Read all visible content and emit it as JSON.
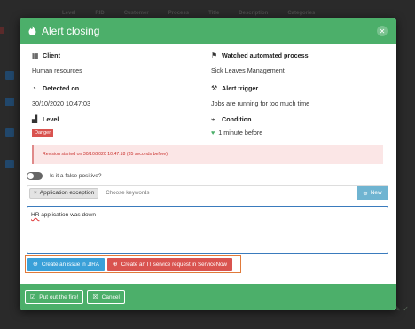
{
  "background": {
    "columns": [
      "Level",
      "RID",
      "Customer",
      "Process",
      "Title",
      "Description",
      "Categories"
    ]
  },
  "modal": {
    "title": "Alert closing",
    "client": {
      "label": "Client",
      "value": "Human resources"
    },
    "process": {
      "label": "Watched automated process",
      "value": "Sick Leaves Management"
    },
    "detected": {
      "label": "Detected on",
      "value": "30/10/2020 10:47:03"
    },
    "trigger": {
      "label": "Alert trigger",
      "value": "Jobs are running for too much time"
    },
    "level": {
      "label": "Level",
      "value": "Danger"
    },
    "condition": {
      "label": "Condition",
      "value": "1 minute before"
    },
    "revision_notice": "Revision started on 30/10/2020 10:47:18 (35 seconds before)",
    "false_positive_label": "Is it a false positive?",
    "tag": "Application exception",
    "tag_remove": "×",
    "keyword_placeholder": "Choose keywords",
    "new_button": "New",
    "comment": {
      "first": "HR",
      "rest": " application was down"
    },
    "jira_button": "Create an issue in JIRA",
    "servicenow_button": "Create an IT service request in ServiceNow",
    "putout_button": "Put out the fire!",
    "cancel_button": "Cancel"
  },
  "colors": {
    "header": "#4caf6a",
    "danger": "#d9534f",
    "jira": "#3aa0d8",
    "highlight": "#e07a3a"
  },
  "icons": {
    "header": "fire-icon",
    "client": "building-icon",
    "process": "flag-icon",
    "detected": "clock-icon",
    "trigger": "gavel-icon",
    "level": "signal-icon",
    "condition": "heartbeat-icon"
  }
}
